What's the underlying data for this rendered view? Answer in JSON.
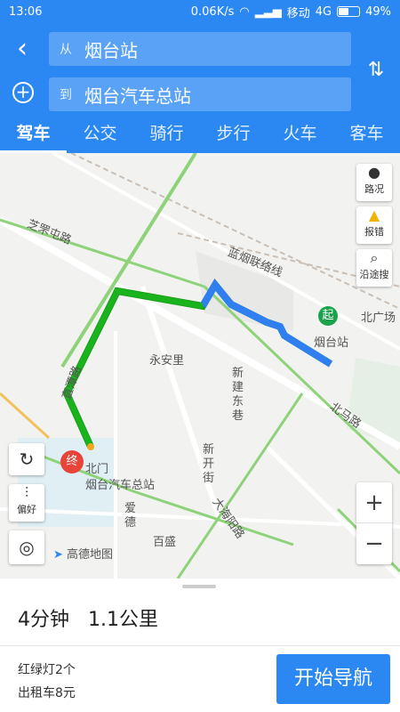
{
  "statusbar": {
    "time": "13:06",
    "speed": "0.06K/s",
    "carrier": "移动",
    "network": "4G",
    "battery": "49%"
  },
  "route": {
    "from_prefix": "从",
    "from_value": "烟台站",
    "to_prefix": "到",
    "to_value": "烟台汽车总站"
  },
  "tabs": [
    "驾车",
    "公交",
    "骑行",
    "步行",
    "火车",
    "客车"
  ],
  "map": {
    "labels": {
      "road1": "芝罘屯路",
      "road2": "蓝烟联络线",
      "road3": "永安里",
      "road4": "新建东巷",
      "road5": "新开街",
      "road6": "北马路",
      "road7": "大海阳路",
      "road8": "爱德",
      "road9": "百盛",
      "road10": "北广场",
      "road11": "烟台站",
      "road12": "北门",
      "road13": "烟台汽车总站",
      "road14": "直潭路",
      "start_marker": "起",
      "end_marker": "终"
    },
    "controls": {
      "traffic": "路况",
      "report": "报错",
      "search_along": "沿途搜",
      "preference": "偏好",
      "zoom_in": "+",
      "zoom_out": "−"
    },
    "logo": "高德地图"
  },
  "bottom": {
    "duration": "4分钟",
    "distance": "1.1公里",
    "traffic_lights": "红绿灯2个",
    "taxi": "出租车8元",
    "start_button": "开始导航"
  }
}
